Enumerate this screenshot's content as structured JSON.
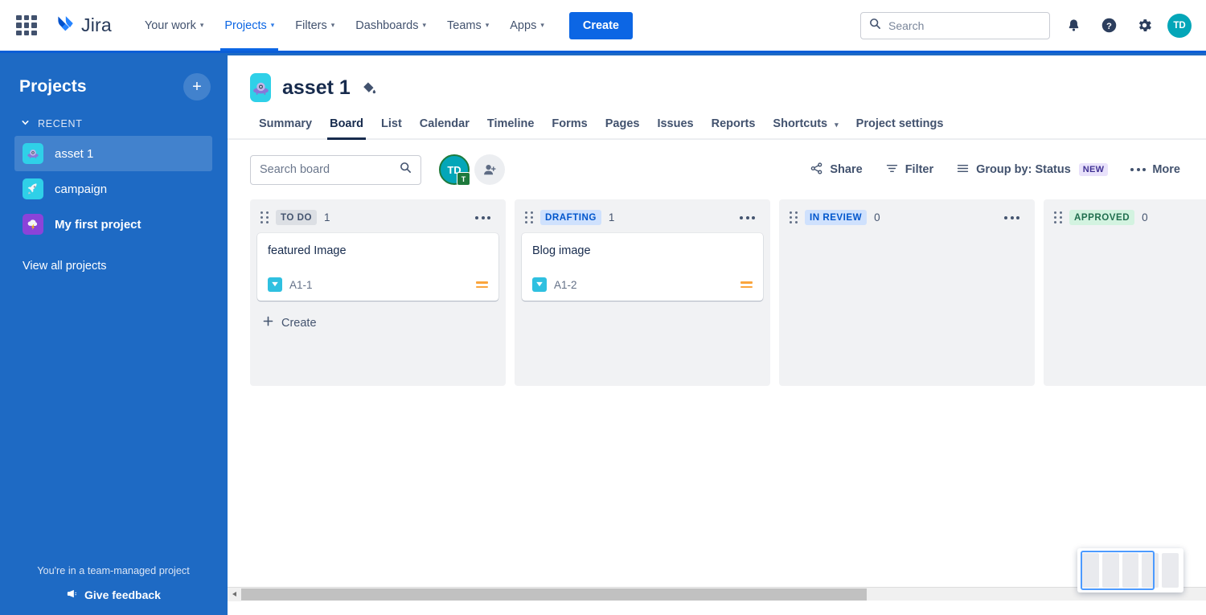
{
  "topnav": {
    "app_switcher_label": "app-switcher",
    "brand": "Jira",
    "items": [
      {
        "label": "Your work",
        "has_chevron": true,
        "active": false
      },
      {
        "label": "Projects",
        "has_chevron": true,
        "active": true
      },
      {
        "label": "Filters",
        "has_chevron": true,
        "active": false
      },
      {
        "label": "Dashboards",
        "has_chevron": true,
        "active": false
      },
      {
        "label": "Teams",
        "has_chevron": true,
        "active": false
      },
      {
        "label": "Apps",
        "has_chevron": true,
        "active": false
      }
    ],
    "create_label": "Create",
    "search_placeholder": "Search",
    "search_value": "",
    "icons": [
      "notifications-icon",
      "help-icon",
      "settings-icon"
    ],
    "avatar_initials": "TD",
    "avatar_color": "#04a6b8",
    "accent_color": "#0c66e4"
  },
  "sidebar": {
    "title": "Projects",
    "add_label": "+",
    "section_label": "RECENT",
    "items": [
      {
        "label": "asset 1",
        "icon": "ufo-icon",
        "icon_bg": "#2fd0e8",
        "glyph": "🛸",
        "active": true,
        "bold": false
      },
      {
        "label": "campaign",
        "icon": "rocket-icon",
        "icon_bg": "#2fd0e8",
        "glyph": "🚀",
        "active": false,
        "bold": false
      },
      {
        "label": "My first project",
        "icon": "storm-icon",
        "icon_bg": "#8b43d9",
        "glyph": "⛈️",
        "active": false,
        "bold": true
      }
    ],
    "view_all_label": "View all projects",
    "footer_note": "You're in a team-managed project",
    "feedback_label": "Give feedback",
    "bg_color": "#1e6ac4"
  },
  "project": {
    "icon_glyph": "🛸",
    "icon_bg": "#2fd0e8",
    "name": "asset 1",
    "edit_icon": "paint-bucket-icon",
    "tabs": [
      {
        "label": "Summary",
        "active": false
      },
      {
        "label": "Board",
        "active": true
      },
      {
        "label": "List",
        "active": false
      },
      {
        "label": "Calendar",
        "active": false
      },
      {
        "label": "Timeline",
        "active": false
      },
      {
        "label": "Forms",
        "active": false
      },
      {
        "label": "Pages",
        "active": false
      },
      {
        "label": "Issues",
        "active": false
      },
      {
        "label": "Reports",
        "active": false
      },
      {
        "label": "Shortcuts",
        "active": false,
        "has_chevron": true
      },
      {
        "label": "Project settings",
        "active": false
      }
    ]
  },
  "toolbar": {
    "search_placeholder": "Search board",
    "search_value": "",
    "member_initials": "TD",
    "member_badge": "T",
    "add_people_label": "add-people",
    "share_label": "Share",
    "filter_label": "Filter",
    "group_by_label": "Group by: Status",
    "group_by_badge": "NEW",
    "more_label": "More"
  },
  "board": {
    "columns": [
      {
        "status": "TO DO",
        "chip_class": "chip-todo",
        "count": "1",
        "create_label": "Create",
        "show_create": true,
        "cards": [
          {
            "title": "featured Image",
            "key": "A1-1",
            "type_icon": "task-icon",
            "type_color": "#2fc0e0",
            "priority": "medium",
            "priority_color": "#faa53d"
          }
        ]
      },
      {
        "status": "DRAFTING",
        "chip_class": "chip-drafting",
        "count": "1",
        "create_label": "Create",
        "show_create": false,
        "cards": [
          {
            "title": "Blog image",
            "key": "A1-2",
            "type_icon": "task-icon",
            "type_color": "#2fc0e0",
            "priority": "medium",
            "priority_color": "#faa53d"
          }
        ]
      },
      {
        "status": "IN REVIEW",
        "chip_class": "chip-review",
        "count": "0",
        "create_label": "Create",
        "show_create": false,
        "cards": []
      },
      {
        "status": "APPROVED",
        "chip_class": "chip-approved",
        "count": "0",
        "create_label": "Create",
        "show_create": false,
        "cards": []
      }
    ]
  },
  "minimap": {
    "columns": 5,
    "viewport_start": 0,
    "viewport_end": 4
  },
  "scrollbar": {
    "position_pct": 0,
    "thumb_pct": 64
  }
}
